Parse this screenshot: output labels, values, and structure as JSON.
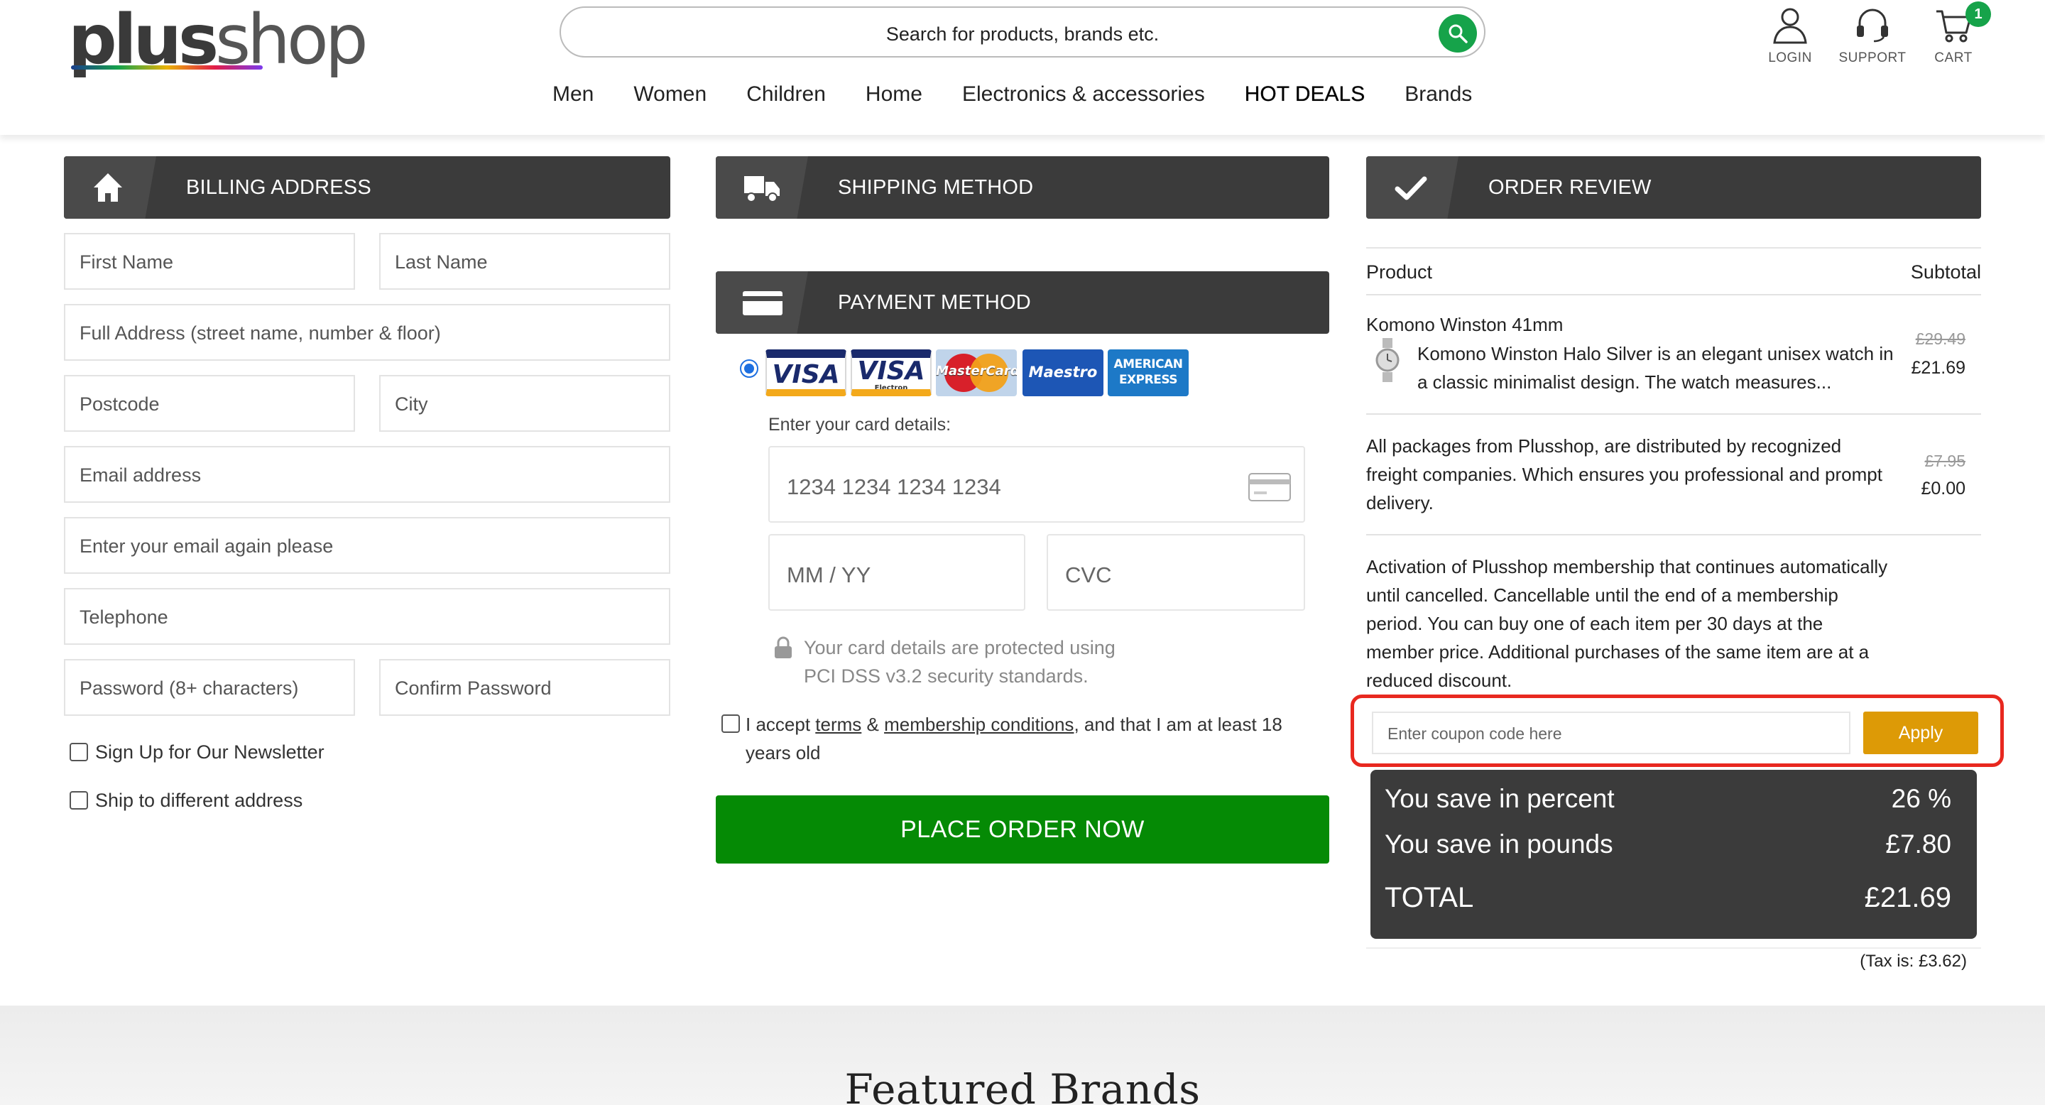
{
  "header": {
    "logo_bold": "plus",
    "logo_thin": "shop",
    "search_placeholder": "Search for products, brands etc.",
    "login_label": "LOGIN",
    "support_label": "SUPPORT",
    "cart_label": "CART",
    "cart_count": "1"
  },
  "nav": {
    "items": [
      "Men",
      "Women",
      "Children",
      "Home",
      "Electronics & accessories",
      "HOT DEALS",
      "Brands"
    ]
  },
  "billing": {
    "title": "BILLING ADDRESS",
    "first_name": "First Name",
    "last_name": "Last Name",
    "full_address": "Full Address (street name, number & floor)",
    "postcode": "Postcode",
    "city": "City",
    "email": "Email address",
    "email_again": "Enter your email again please",
    "telephone": "Telephone",
    "password": "Password (8+ characters)",
    "confirm_password": "Confirm Password",
    "newsletter": "Sign Up for Our Newsletter",
    "ship_different": "Ship to different address"
  },
  "shipping": {
    "title": "SHIPPING METHOD"
  },
  "payment": {
    "title": "PAYMENT METHOD",
    "cards": {
      "visa": "VISA",
      "visa_electron": "VISA",
      "visa_electron_sub": "Electron",
      "mastercard": "MasterCard",
      "maestro": "Maestro",
      "amex_line1": "AMERICAN",
      "amex_line2": "EXPRESS"
    },
    "card_details_label": "Enter your card details:",
    "card_number_placeholder": "1234 1234 1234 1234",
    "expiry_placeholder": "MM / YY",
    "cvc_placeholder": "CVC",
    "secure_line1": "Your card details are protected using",
    "secure_line2": "PCI DSS v3.2 security standards.",
    "terms_pre": "I accept ",
    "terms_link": "terms",
    "terms_amp": " & ",
    "membership_link": "membership conditions",
    "terms_post": ", and that I am at least 18 years old",
    "place_order": "PLACE ORDER NOW"
  },
  "review": {
    "title": "ORDER REVIEW",
    "col_product": "Product",
    "col_subtotal": "Subtotal",
    "product_name": "Komono Winston 41mm",
    "product_desc": "Komono Winston Halo Silver is an elegant unisex watch in a classic minimalist design. The watch measures...",
    "product_old_price": "£29.49",
    "product_price": "£21.69",
    "shipping_desc": "All packages from Plusshop, are distributed by recognized freight companies. Which ensures you professional and prompt delivery.",
    "shipping_old_price": "£7.95",
    "shipping_price": "£0.00",
    "membership_desc": "Activation of Plusshop membership that continues automatically until cancelled. Cancellable until the end of a membership period. You can buy one of each item per 30 days at the member price. Additional purchases of the same item are at a reduced discount.",
    "coupon_placeholder": "Enter coupon code here",
    "apply_label": "Apply",
    "save_percent_label": "You save in percent",
    "save_percent_value": "26 %",
    "save_pounds_label": "You save in pounds",
    "save_pounds_value": "£7.80",
    "total_label": "TOTAL",
    "total_value": "£21.69",
    "tax": "(Tax is: £3.62)"
  },
  "footer": {
    "featured_title": "Featured Brands"
  },
  "colors": {
    "accent_green": "#16a34a",
    "place_order_green": "#058a05",
    "apply_orange": "#dd9a06",
    "highlight_red": "#e8281f",
    "bar_dark": "#3b3b3b"
  }
}
